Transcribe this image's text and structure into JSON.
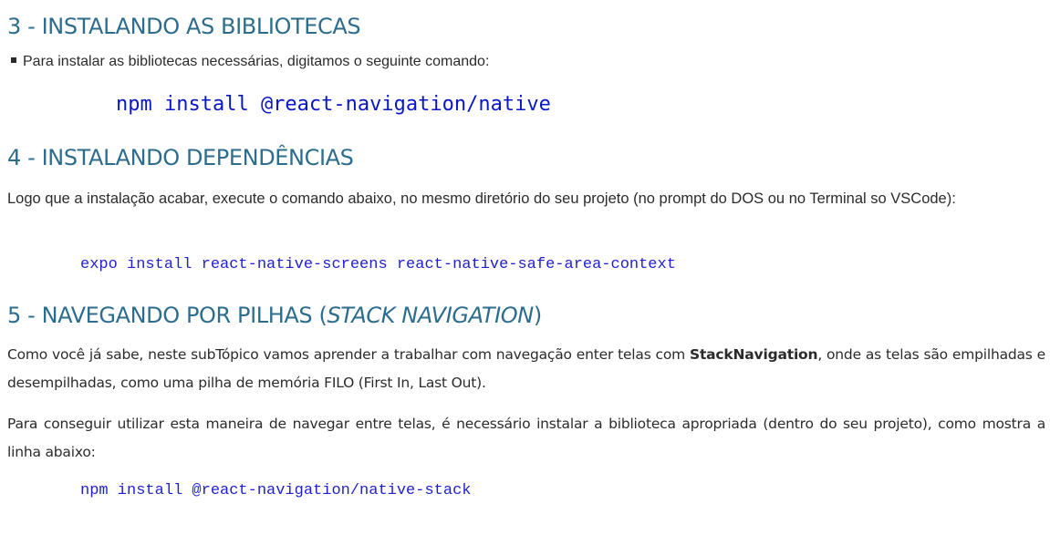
{
  "section3": {
    "title": "3 - INSTALANDO AS BIBLIOTECAS",
    "bullet": "Para instalar as bibliotecas necessárias, digitamos o seguinte comando:",
    "command": "npm install @react-navigation/native"
  },
  "section4": {
    "title": "4 - INSTALANDO DEPENDÊNCIAS",
    "paragraph": "Logo que a instalação acabar, execute o comando abaixo, no mesmo diretório do seu projeto (no prompt do DOS ou no Terminal so VSCode):",
    "command": "expo install react-native-screens react-native-safe-area-context"
  },
  "section5": {
    "title_prefix": "5 - NAVEGANDO POR PILHAS (",
    "title_em": "STACK NAVIGATION",
    "title_suffix": ")",
    "para1_before": "Como você já sabe, neste subTópico vamos aprender a trabalhar com navegação enter telas com ",
    "para1_bold": "StackNavigation",
    "para1_after": ", onde as telas são empilhadas e desempilhadas, como uma pilha de memória FILO (First In, Last Out).",
    "para2": "Para conseguir utilizar esta maneira de navegar entre telas, é necessário instalar a biblioteca apropriada (dentro do seu projeto), como mostra a linha abaixo:",
    "command": "npm install @react-navigation/native-stack"
  }
}
